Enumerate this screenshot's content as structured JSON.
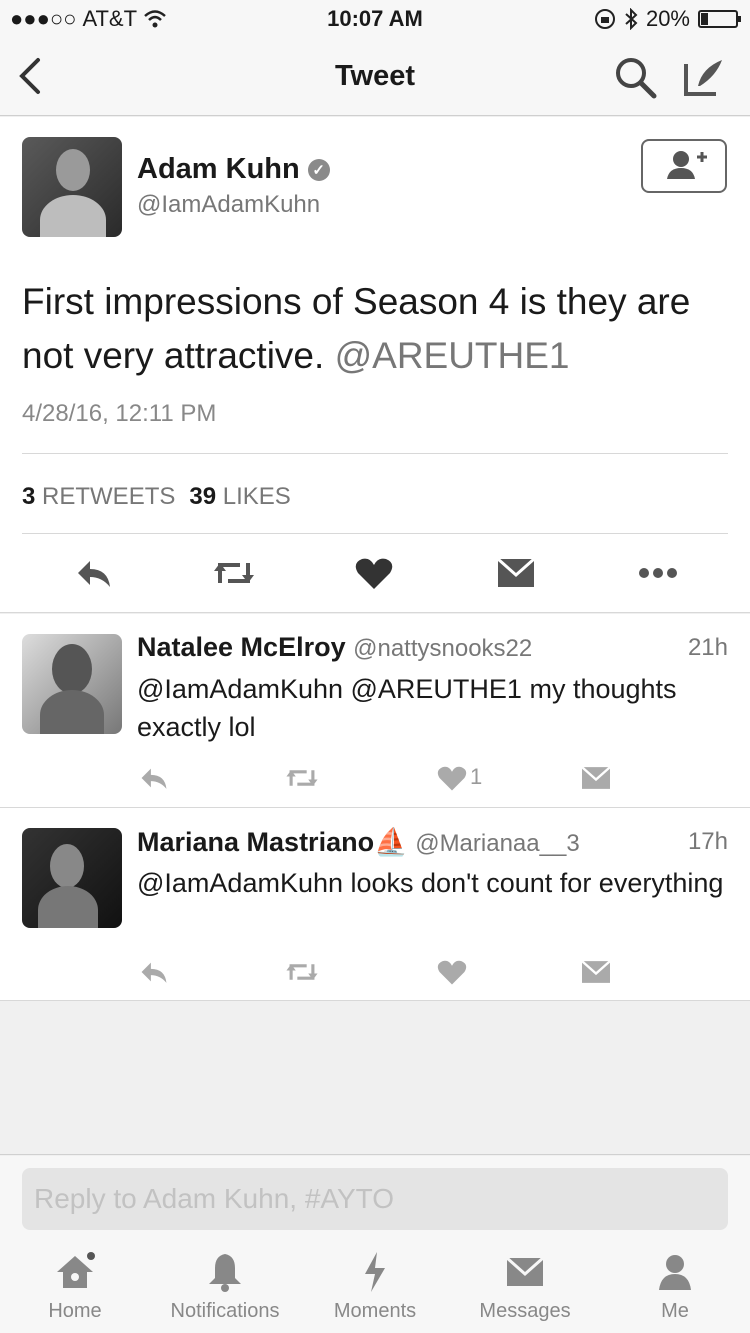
{
  "status": {
    "carrier": "AT&T",
    "signal": "●●●○○",
    "time": "10:07 AM",
    "battery_label": "20%",
    "battery_level": 0.2
  },
  "nav": {
    "title": "Tweet"
  },
  "tweet": {
    "name": "Adam Kuhn",
    "handle": "@IamAdamKuhn",
    "text": "First impressions of Season 4 is they are not very attractive.",
    "mention": "@AREUTHE1",
    "date": "4/28/16, 12:11 PM",
    "retweets_count": "3",
    "retweets_label": "RETWEETS",
    "likes_count": "39",
    "likes_label": "LIKES"
  },
  "replies": [
    {
      "name": "Natalee McElroy",
      "handle": "@nattysnooks22",
      "time": "21h",
      "text": "@IamAdamKuhn @AREUTHE1 my thoughts exactly lol",
      "like_count": "1"
    },
    {
      "name": "Mariana Mastriano⛵",
      "handle": "@Marianaa__3",
      "time": "17h",
      "text": "@IamAdamKuhn looks don't count for everything",
      "like_count": ""
    }
  ],
  "reply_box": {
    "placeholder": "Reply to Adam Kuhn, #AYTO"
  },
  "tabs": [
    {
      "label": "Home",
      "icon": "home-icon"
    },
    {
      "label": "Notifications",
      "icon": "bell-icon"
    },
    {
      "label": "Moments",
      "icon": "lightning-icon"
    },
    {
      "label": "Messages",
      "icon": "envelope-icon"
    },
    {
      "label": "Me",
      "icon": "person-icon"
    }
  ]
}
